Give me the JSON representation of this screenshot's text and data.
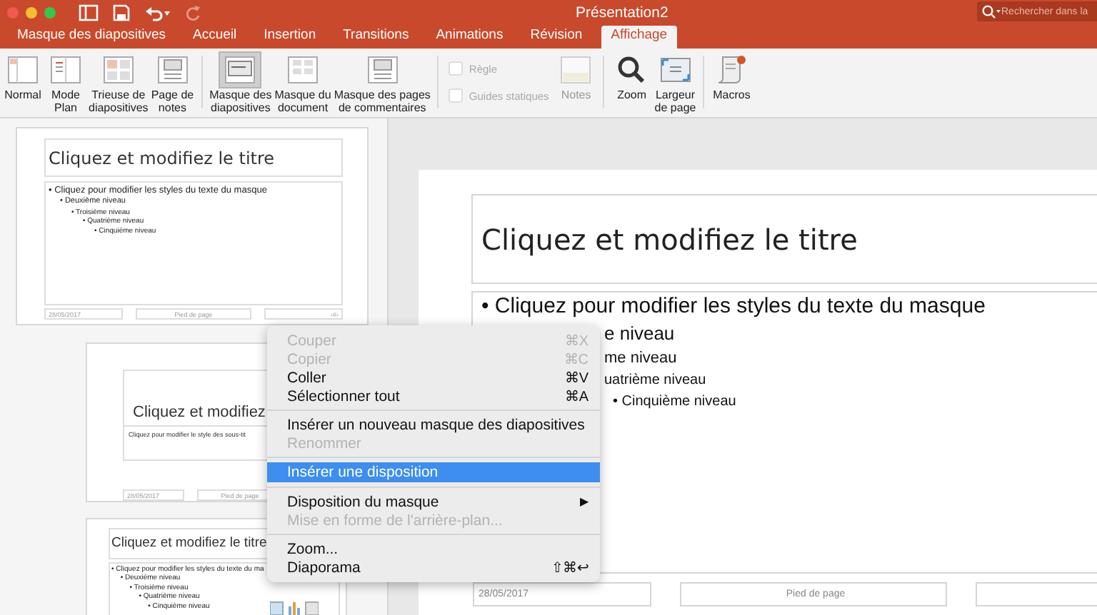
{
  "window": {
    "title": "Présentation2",
    "search_placeholder": "Rechercher dans la"
  },
  "tabs": [
    {
      "label": "Masque des diapositives",
      "selected": false
    },
    {
      "label": "Accueil",
      "selected": false
    },
    {
      "label": "Insertion",
      "selected": false
    },
    {
      "label": "Transitions",
      "selected": false
    },
    {
      "label": "Animations",
      "selected": false
    },
    {
      "label": "Révision",
      "selected": false
    },
    {
      "label": "Affichage",
      "selected": true
    }
  ],
  "ribbon": [
    {
      "buttons": [
        {
          "label": "Normal",
          "selected": false,
          "disabled": false
        },
        {
          "label": "Mode\nPlan",
          "selected": false,
          "disabled": false
        },
        {
          "label": "Trieuse de\ndiapositives",
          "selected": false,
          "disabled": false
        },
        {
          "label": "Page de\nnotes",
          "selected": false,
          "disabled": false
        }
      ]
    },
    {
      "buttons": [
        {
          "label": "Masque des\ndiapositives",
          "selected": true,
          "disabled": false
        },
        {
          "label": "Masque du\ndocument",
          "selected": false,
          "disabled": false
        },
        {
          "label": "Masque des pages\nde commentaires",
          "selected": false,
          "disabled": false
        }
      ]
    },
    {
      "checkboxes": [
        {
          "label": "Règle",
          "checked": false,
          "disabled": true
        },
        {
          "label": "Guides statiques",
          "checked": false,
          "disabled": true
        }
      ],
      "buttons": [
        {
          "label": "Notes",
          "selected": false,
          "disabled": true
        }
      ]
    },
    {
      "buttons": [
        {
          "label": "Zoom",
          "selected": false,
          "disabled": false
        },
        {
          "label": "Largeur\nde page",
          "selected": false,
          "disabled": false
        }
      ]
    },
    {
      "buttons": [
        {
          "label": "Macros",
          "selected": false,
          "disabled": false
        }
      ]
    }
  ],
  "thumbnails": [
    {
      "kind": "master",
      "title": "Cliquez et modifiez le titre",
      "bullets": [
        {
          "text": "• Cliquez pour modifier les styles du texte du masque",
          "children": [
            {
              "text": "• Deuxième niveau",
              "children": [
                {
                  "text": "• Troisième niveau",
                  "children": [
                    {
                      "text": "• Quatrième niveau",
                      "children": [
                        {
                          "text": "• Cinquième niveau"
                        }
                      ]
                    }
                  ]
                }
              ]
            }
          ]
        }
      ],
      "footers": [
        "28/05/2017",
        "Pied de page",
        "‹#›"
      ]
    },
    {
      "kind": "title_layout",
      "title": "Cliquez et modifiez",
      "subtitle": "Cliquez pour modifier le style des sous-tit",
      "footers": [
        "28/05/2017",
        "Pied de page"
      ]
    },
    {
      "kind": "content_layout",
      "title": "Cliquez et modifiez le titre",
      "bullets": [
        {
          "text": "• Cliquez pour modifier les styles du texte du ma",
          "children": [
            {
              "text": "• Deuxième niveau",
              "children": [
                {
                  "text": "• Troisième niveau",
                  "children": [
                    {
                      "text": "• Quatrième niveau",
                      "children": [
                        {
                          "text": "• Cinquième niveau"
                        }
                      ]
                    }
                  ]
                }
              ]
            }
          ]
        }
      ]
    }
  ],
  "slide": {
    "title": "Cliquez et modifiez le titre",
    "bullets": [
      {
        "text": "• Cliquez pour modifier les styles du texte du masque",
        "children": [
          {
            "text": "e niveau",
            "children": [
              {
                "text": "me niveau",
                "children": [
                  {
                    "text": "uatrième niveau",
                    "children": [
                      {
                        "text": "•  Cinquième niveau"
                      }
                    ]
                  }
                ]
              }
            ]
          }
        ]
      }
    ],
    "footers": [
      "28/05/2017",
      "Pied de page"
    ]
  },
  "context_menu": {
    "sections": [
      [
        {
          "label": "Couper",
          "shortcut": "⌘X",
          "disabled": true,
          "selected": false
        },
        {
          "label": "Copier",
          "shortcut": "⌘C",
          "disabled": true,
          "selected": false
        },
        {
          "label": "Coller",
          "shortcut": "⌘V",
          "disabled": false,
          "selected": false
        },
        {
          "label": "Sélectionner tout",
          "shortcut": "⌘A",
          "disabled": false,
          "selected": false
        }
      ],
      [
        {
          "label": "Insérer un nouveau masque des diapositives",
          "disabled": false,
          "selected": false
        },
        {
          "label": "Renommer",
          "disabled": true,
          "selected": false
        }
      ],
      [
        {
          "label": "Insérer une disposition",
          "disabled": false,
          "selected": true
        }
      ],
      [
        {
          "label": "Disposition du masque",
          "submenu_mark": "▶",
          "disabled": false,
          "selected": false
        },
        {
          "label": "Mise en forme de l'arrière-plan...",
          "disabled": true,
          "selected": false
        }
      ],
      [
        {
          "label": "Zoom...",
          "disabled": false,
          "selected": false
        },
        {
          "label": "Diaporama",
          "shortcut": "⇧⌘↩",
          "disabled": false,
          "selected": false
        }
      ]
    ]
  }
}
